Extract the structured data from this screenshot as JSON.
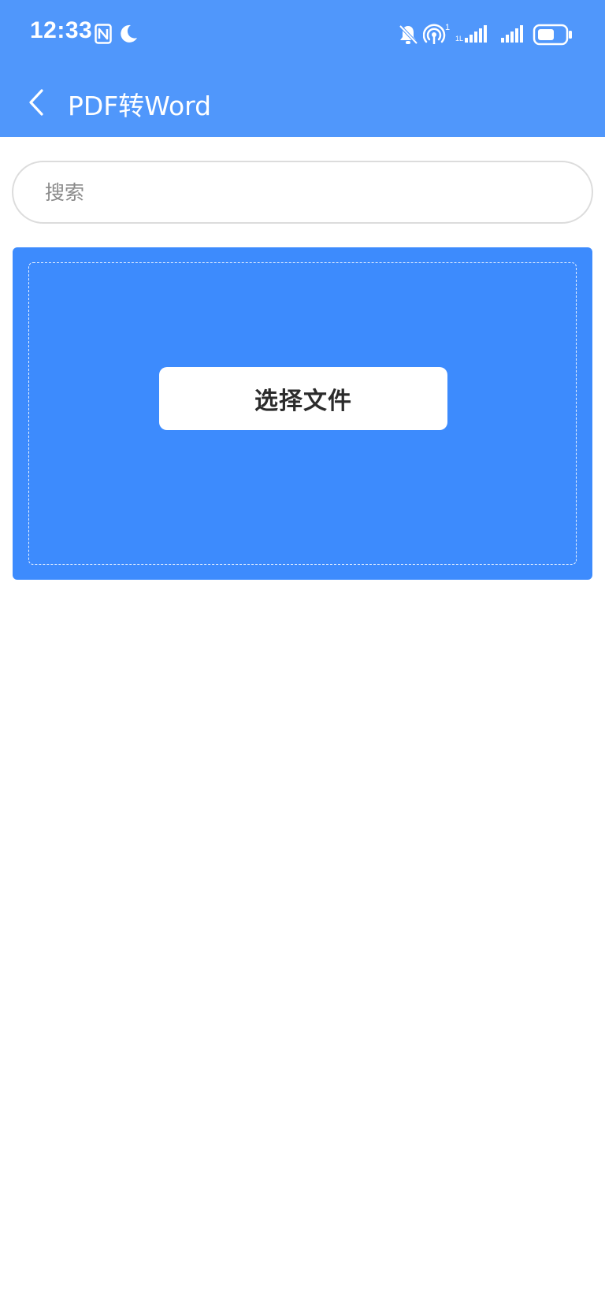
{
  "status_bar": {
    "time": "12:33",
    "icons": [
      "nfc-icon",
      "moon-icon",
      "bell-off-icon",
      "hotspot-icon",
      "signal-icon",
      "signal-icon",
      "battery-icon"
    ],
    "hotspot_count": "1"
  },
  "app_bar": {
    "title": "PDF转Word",
    "back_icon": "chevron-left-icon"
  },
  "search": {
    "placeholder": "搜索",
    "value": ""
  },
  "upload": {
    "button_label": "选择文件"
  },
  "colors": {
    "header_bg": "#5097fb",
    "card_bg": "#3d8bfd",
    "button_bg": "#ffffff",
    "button_text": "#2b2b2b"
  }
}
